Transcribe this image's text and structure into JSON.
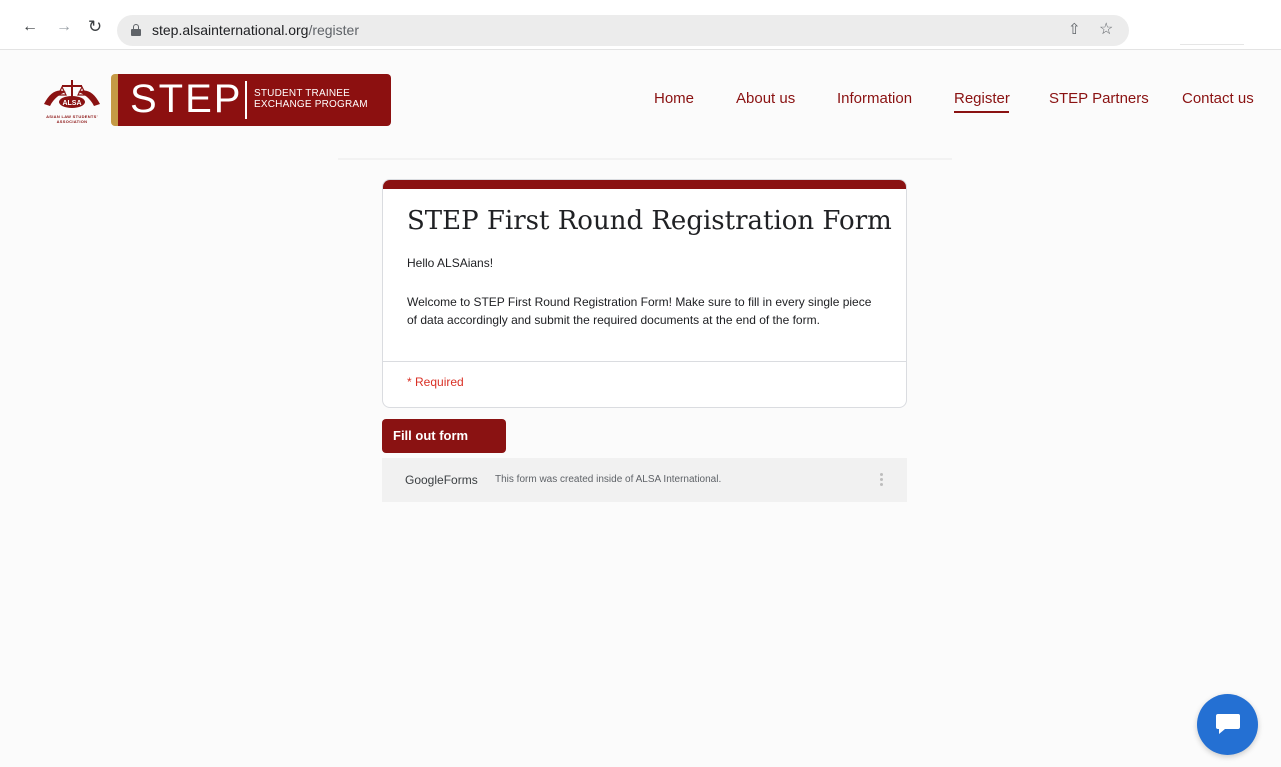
{
  "browser": {
    "url_host": "step.alsainternational.org",
    "url_path": "/register"
  },
  "header": {
    "emblem_text": "ASIAN LAW STUDENTS' ASSOCIATION",
    "emblem_badge": "ALSA",
    "logo_word": "STEP",
    "logo_sub_line1": "STUDENT TRAINEE",
    "logo_sub_line2": "EXCHANGE PROGRAM",
    "nav": {
      "home": "Home",
      "about": "About us",
      "information": "Information",
      "register": "Register",
      "partners": "STEP Partners",
      "contact": "Contact us"
    },
    "active_nav": "Register"
  },
  "form": {
    "title": "STEP First Round Registration Form",
    "greeting": "Hello ALSAians!",
    "description": "Welcome to STEP First Round Registration Form! Make sure to fill in every single piece of data accordingly and submit the required documents at the end of the form.",
    "required_note": "* Required",
    "fill_button": "Fill out form"
  },
  "footer": {
    "google_forms": "GoogleForms",
    "note": "This form was created inside of ALSA International."
  },
  "colors": {
    "brand": "#8a1212",
    "accent_gold": "#c59a45",
    "chat": "#2470d3",
    "required": "#d93025"
  },
  "icons": [
    "back-arrow-icon",
    "forward-arrow-icon",
    "reload-icon",
    "lock-icon",
    "share-icon",
    "star-icon",
    "kebab-icon",
    "chat-icon"
  ]
}
